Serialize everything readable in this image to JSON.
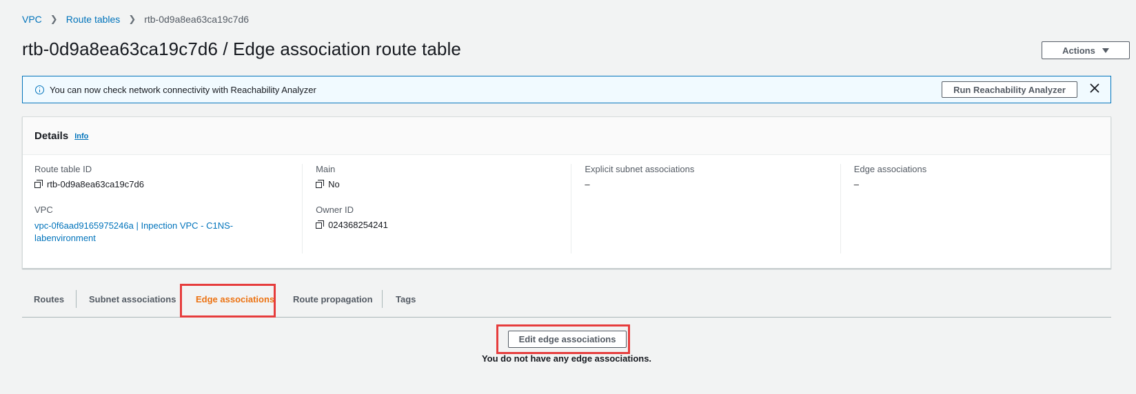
{
  "breadcrumb": {
    "items": [
      {
        "label": "VPC"
      },
      {
        "label": "Route tables"
      },
      {
        "label": "rtb-0d9a8ea63ca19c7d6"
      }
    ]
  },
  "header": {
    "title": "rtb-0d9a8ea63ca19c7d6 / Edge association route table",
    "actions_label": "Actions"
  },
  "flash": {
    "message": "You can now check network connectivity with Reachability Analyzer",
    "button_label": "Run Reachability Analyzer"
  },
  "details": {
    "title": "Details",
    "info_label": "Info",
    "fields": {
      "route_table_id": {
        "label": "Route table ID",
        "value": "rtb-0d9a8ea63ca19c7d6"
      },
      "vpc": {
        "label": "VPC",
        "value_line1": "vpc-0f6aad9165975246a | Inpection VPC - C1NS-",
        "value_line2": "labenvironment"
      },
      "main": {
        "label": "Main",
        "value": "No"
      },
      "owner_id": {
        "label": "Owner ID",
        "value": "024368254241"
      },
      "explicit_subnet": {
        "label": "Explicit subnet associations",
        "value": "–"
      },
      "edge_associations": {
        "label": "Edge associations",
        "value": "–"
      }
    }
  },
  "tabs": {
    "items": [
      {
        "label": "Routes"
      },
      {
        "label": "Subnet associations"
      },
      {
        "label": "Edge associations",
        "active": true
      },
      {
        "label": "Route propagation"
      },
      {
        "label": "Tags"
      }
    ]
  },
  "edge_panel": {
    "edit_button_label": "Edit edge associations",
    "empty_message": "You do not have any edge associations."
  },
  "colors": {
    "link": "#0073bb",
    "active_tab": "#ec7211",
    "highlight": "#e63c3c",
    "flash_bg": "#f1faff"
  }
}
